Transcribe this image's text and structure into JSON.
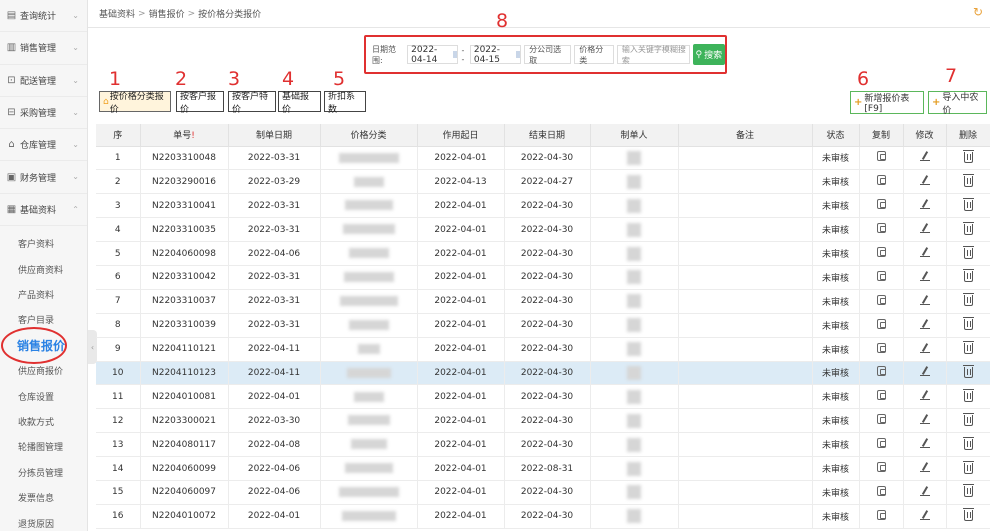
{
  "sidebar": {
    "menus": [
      {
        "label": "查询统计",
        "icon": "report-icon"
      },
      {
        "label": "销售管理",
        "icon": "chart-icon"
      },
      {
        "label": "配送管理",
        "icon": "delivery-icon"
      },
      {
        "label": "采购管理",
        "icon": "cart-icon"
      },
      {
        "label": "仓库管理",
        "icon": "warehouse-icon"
      },
      {
        "label": "财务管理",
        "icon": "finance-icon"
      },
      {
        "label": "基础资料",
        "icon": "data-icon"
      }
    ],
    "sub_items": [
      "客户资料",
      "供应商资料",
      "产品资料",
      "客户目录",
      "销售报价",
      "供应商报价",
      "仓库设置",
      "收款方式",
      "轮播图管理",
      "分拣员管理",
      "发票信息",
      "退货原因"
    ]
  },
  "breadcrumb": [
    "基础资料",
    "销售报价",
    "按价格分类报价"
  ],
  "filter": {
    "date_label": "日期范围:",
    "date_from": "2022-04-14",
    "date_sep": "--",
    "date_to": "2022-04-15",
    "branch_select": "分公司选取",
    "category_select": "价格分类",
    "keyword_placeholder": "输入关键字模糊搜索",
    "search_label": "搜索"
  },
  "tabs": [
    "按价格分类报价",
    "按客户报价",
    "按客户特价",
    "基础报价",
    "折扣系数"
  ],
  "right_buttons": {
    "new_label": "新增报价表[F9]",
    "import_label": "导入中农价"
  },
  "annotations": [
    "1",
    "2",
    "3",
    "4",
    "5",
    "6",
    "7",
    "8"
  ],
  "table": {
    "headers": [
      "序",
      "单号",
      "制单日期",
      "价格分类",
      "作用起日",
      "结束日期",
      "制单人",
      "备注",
      "状态",
      "复制",
      "修改",
      "删除"
    ],
    "required_mark": "!",
    "rows": [
      {
        "no": "1",
        "order": "N2203310048",
        "date": "2022-03-31",
        "start": "2022-04-01",
        "end": "2022-04-30",
        "status": "未审核"
      },
      {
        "no": "2",
        "order": "N2203290016",
        "date": "2022-03-29",
        "start": "2022-04-13",
        "end": "2022-04-27",
        "status": "未审核"
      },
      {
        "no": "3",
        "order": "N2203310041",
        "date": "2022-03-31",
        "start": "2022-04-01",
        "end": "2022-04-30",
        "status": "未审核"
      },
      {
        "no": "4",
        "order": "N2203310035",
        "date": "2022-03-31",
        "start": "2022-04-01",
        "end": "2022-04-30",
        "status": "未审核"
      },
      {
        "no": "5",
        "order": "N2204060098",
        "date": "2022-04-06",
        "start": "2022-04-01",
        "end": "2022-04-30",
        "status": "未审核"
      },
      {
        "no": "6",
        "order": "N2203310042",
        "date": "2022-03-31",
        "start": "2022-04-01",
        "end": "2022-04-30",
        "status": "未审核"
      },
      {
        "no": "7",
        "order": "N2203310037",
        "date": "2022-03-31",
        "start": "2022-04-01",
        "end": "2022-04-30",
        "status": "未审核"
      },
      {
        "no": "8",
        "order": "N2203310039",
        "date": "2022-03-31",
        "start": "2022-04-01",
        "end": "2022-04-30",
        "status": "未审核"
      },
      {
        "no": "9",
        "order": "N2204110121",
        "date": "2022-04-11",
        "start": "2022-04-01",
        "end": "2022-04-30",
        "status": "未审核"
      },
      {
        "no": "10",
        "order": "N2204110123",
        "date": "2022-04-11",
        "start": "2022-04-01",
        "end": "2022-04-30",
        "status": "未审核"
      },
      {
        "no": "11",
        "order": "N2204010081",
        "date": "2022-04-01",
        "start": "2022-04-01",
        "end": "2022-04-30",
        "status": "未审核"
      },
      {
        "no": "12",
        "order": "N2203300021",
        "date": "2022-03-30",
        "start": "2022-04-01",
        "end": "2022-04-30",
        "status": "未审核"
      },
      {
        "no": "13",
        "order": "N2204080117",
        "date": "2022-04-08",
        "start": "2022-04-01",
        "end": "2022-04-30",
        "status": "未审核"
      },
      {
        "no": "14",
        "order": "N2204060099",
        "date": "2022-04-06",
        "start": "2022-04-01",
        "end": "2022-08-31",
        "status": "未审核"
      },
      {
        "no": "15",
        "order": "N2204060097",
        "date": "2022-04-06",
        "start": "2022-04-01",
        "end": "2022-04-30",
        "status": "未审核"
      },
      {
        "no": "16",
        "order": "N2204010072",
        "date": "2022-04-01",
        "start": "2022-04-01",
        "end": "2022-04-30",
        "status": "未审核"
      }
    ]
  },
  "colors": {
    "accent_red": "#e03030",
    "search_green": "#3db35a",
    "active_blue": "#2a82e4",
    "highlight_row": "#dcebf6"
  }
}
